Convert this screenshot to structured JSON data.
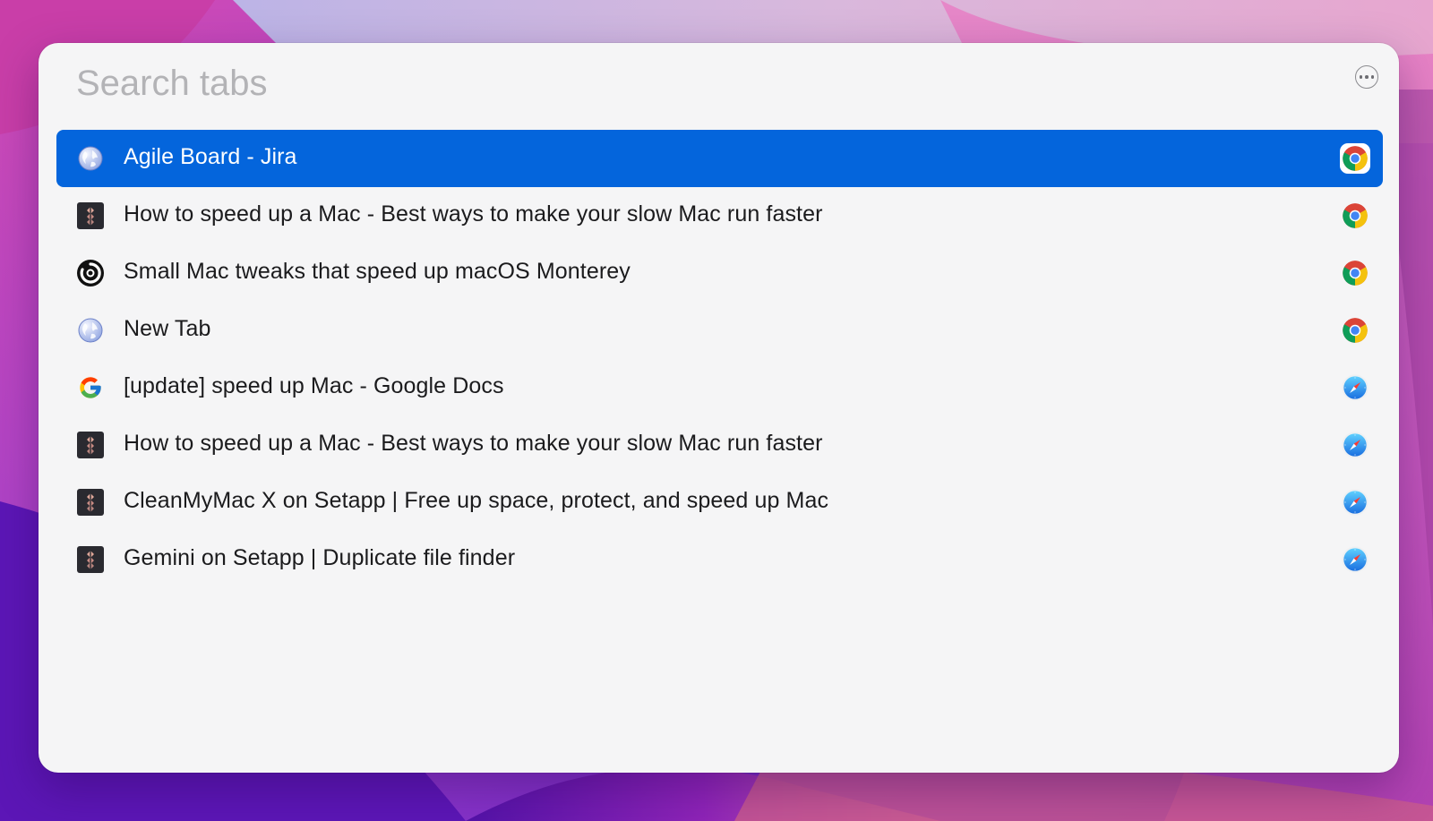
{
  "search": {
    "placeholder": "Search tabs",
    "value": ""
  },
  "more_button": {
    "icon": "ellipsis-circle-icon"
  },
  "colors": {
    "selection": "#0465dc",
    "panel_background": "#f5f5f6",
    "placeholder": "#b3b3b6"
  },
  "tabs": [
    {
      "title": "Agile Board - Jira",
      "favicon": "globe-icon",
      "browser": "chrome-icon",
      "selected": true
    },
    {
      "title": "How to speed up a Mac - Best ways to make your slow Mac run faster",
      "favicon": "setapp-icon",
      "browser": "chrome-icon",
      "selected": false
    },
    {
      "title": "Small Mac tweaks that speed up macOS Monterey",
      "favicon": "swirl-logo-icon",
      "browser": "chrome-icon",
      "selected": false
    },
    {
      "title": "New Tab",
      "favicon": "globe-icon",
      "browser": "chrome-icon",
      "selected": false
    },
    {
      "title": "[update] speed up Mac - Google Docs",
      "favicon": "google-icon",
      "browser": "safari-icon",
      "selected": false
    },
    {
      "title": "How to speed up a Mac - Best ways to make your slow Mac run faster",
      "favicon": "setapp-icon",
      "browser": "safari-icon",
      "selected": false
    },
    {
      "title": "CleanMyMac X on Setapp | Free up space, protect, and speed up Mac",
      "favicon": "setapp-icon",
      "browser": "safari-icon",
      "selected": false
    },
    {
      "title": "Gemini on Setapp | Duplicate file finder",
      "favicon": "setapp-icon",
      "browser": "safari-icon",
      "selected": false
    }
  ]
}
